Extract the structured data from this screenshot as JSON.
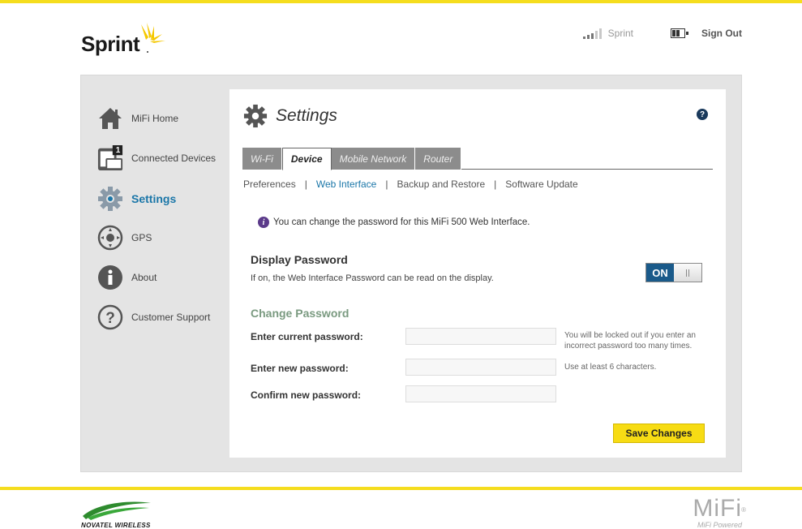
{
  "header": {
    "brand": "Sprint",
    "carrier": "Sprint",
    "sign_out": "Sign Out",
    "signal_icon": "signal-bars-icon",
    "battery_icon": "battery-icon",
    "colors": {
      "accent": "#f5dd1e"
    }
  },
  "sidebar": {
    "items": [
      {
        "label": "MiFi Home",
        "icon": "home-icon",
        "active": false
      },
      {
        "label": "Connected Devices",
        "icon": "devices-icon",
        "badge": "1",
        "active": false
      },
      {
        "label": "Settings",
        "icon": "gear-icon",
        "active": true
      },
      {
        "label": "GPS",
        "icon": "gps-icon",
        "active": false
      },
      {
        "label": "About",
        "icon": "info-icon",
        "active": false
      },
      {
        "label": "Customer Support",
        "icon": "question-icon",
        "active": false
      }
    ]
  },
  "main": {
    "title": "Settings",
    "help_label": "?",
    "tabs": [
      {
        "label": "Wi-Fi",
        "active": false
      },
      {
        "label": "Device",
        "active": true
      },
      {
        "label": "Mobile Network",
        "active": false
      },
      {
        "label": "Router",
        "active": false
      }
    ],
    "subnav": [
      {
        "label": "Preferences",
        "active": false
      },
      {
        "label": "Web Interface",
        "active": true
      },
      {
        "label": "Backup and Restore",
        "active": false
      },
      {
        "label": "Software Update",
        "active": false
      }
    ],
    "info_text": "You can change the password for this MiFi 500 Web Interface.",
    "display_password": {
      "title": "Display Password",
      "description": "If on, the Web Interface Password can be read on the display.",
      "toggle_label": "ON",
      "toggle_state": "on"
    },
    "change_password": {
      "title": "Change Password",
      "current_label": "Enter current password:",
      "current_value": "",
      "current_hint": "You will be locked out if you enter an incorrect password too many times.",
      "new_label": "Enter new password:",
      "new_value": "",
      "new_hint": "Use at least 6 characters.",
      "confirm_label": "Confirm new password:",
      "confirm_value": ""
    },
    "save_label": "Save Changes"
  },
  "footer": {
    "left_brand": "NOVATEL WIRELESS",
    "right_brand": "MiFi",
    "right_trademark": "®",
    "right_tagline": "MiFi Powered"
  }
}
